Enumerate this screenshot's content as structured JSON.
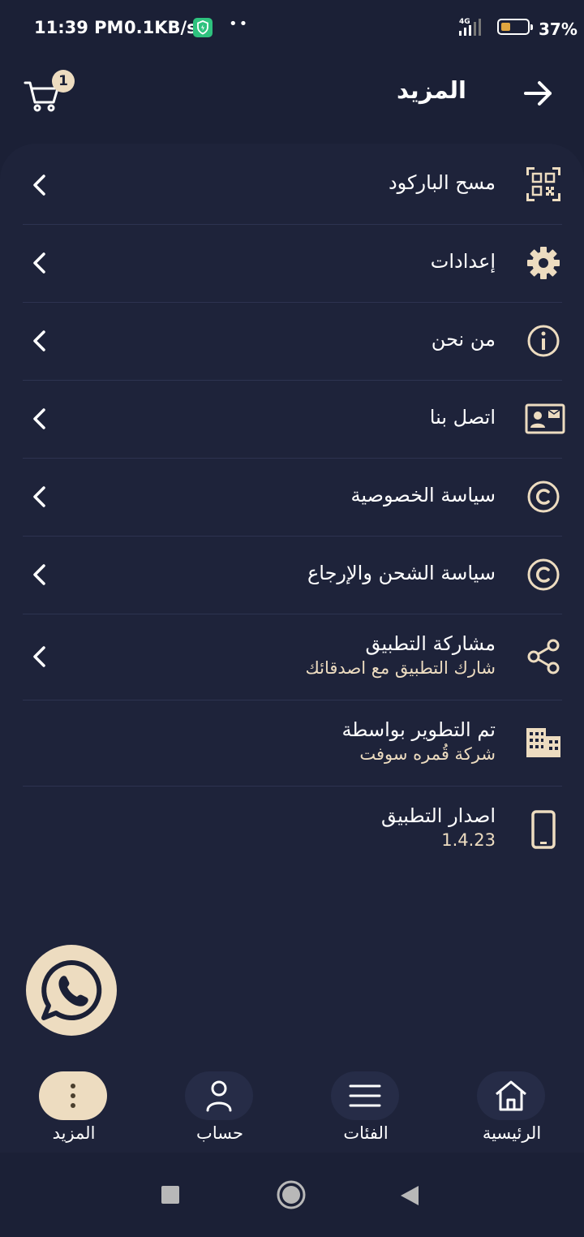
{
  "status_bar": {
    "time": "11:39 PM",
    "speed": "0.1KB/s",
    "network": "4G",
    "battery": "37%",
    "battery_level": 0.37
  },
  "header": {
    "title": "المزيد",
    "cart_count": "1",
    "icons": [
      "cart-icon",
      "arrow-right-icon"
    ]
  },
  "menu": [
    {
      "title": "مسح الباركود",
      "icon": "qr-code-icon"
    },
    {
      "title": "إعدادات",
      "icon": "gear-icon"
    },
    {
      "title": "من نحن",
      "icon": "info-icon"
    },
    {
      "title": "اتصل بنا",
      "icon": "contact-card-icon"
    },
    {
      "title": "سياسة الخصوصية",
      "icon": "copyright-icon"
    },
    {
      "title": "سياسة الشحن والإرجاع",
      "icon": "copyright-icon"
    },
    {
      "title": "مشاركة التطبيق",
      "subtitle": "شارك التطبيق مع اصدقائك",
      "icon": "share-icon"
    },
    {
      "title": "تم التطوير بواسطة",
      "subtitle": "شركة قُمره سوفت",
      "icon": "building-icon"
    },
    {
      "title": "اصدار التطبيق",
      "subtitle": "1.4.23",
      "icon": "phone-icon"
    }
  ],
  "bottom_nav": [
    {
      "label": "المزيد",
      "icon": "more-vertical-icon",
      "active": true
    },
    {
      "label": "حساب",
      "icon": "person-icon",
      "active": false
    },
    {
      "label": "الفئات",
      "icon": "menu-icon",
      "active": false
    },
    {
      "label": "الرئيسية",
      "icon": "home-icon",
      "active": false
    }
  ],
  "colors": {
    "background": "#1b2036",
    "panel": "#1e233a",
    "accent": "#eddcc0"
  }
}
